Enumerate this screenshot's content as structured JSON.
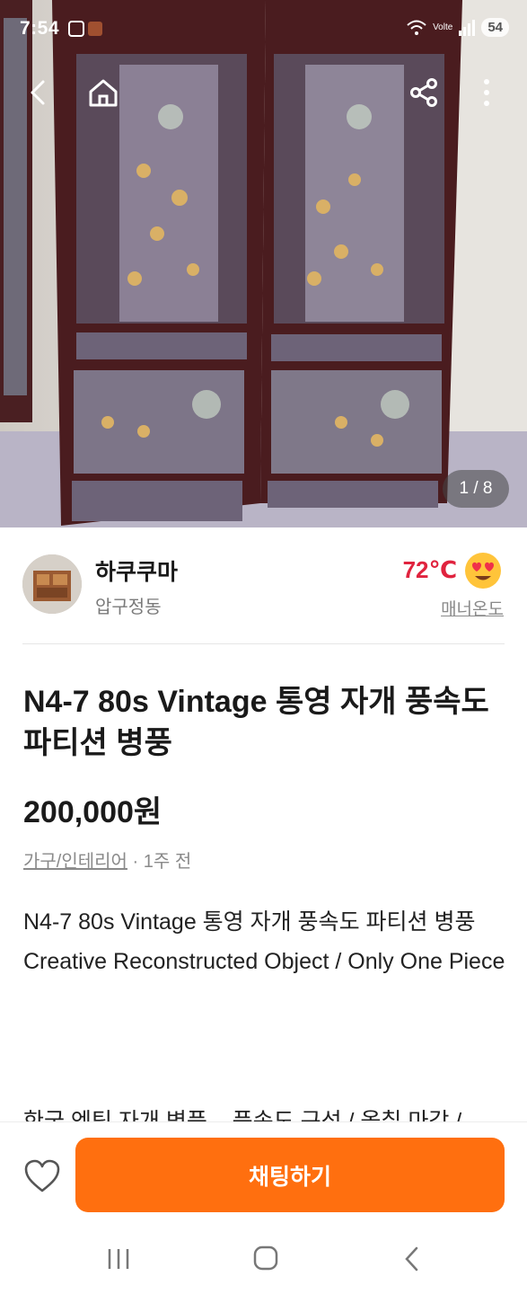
{
  "status_bar": {
    "time": "7:54",
    "network": "Volte",
    "battery": "54"
  },
  "gallery": {
    "counter": "1 / 8"
  },
  "seller": {
    "name": "하쿠쿠마",
    "location": "압구정동",
    "temperature": "72℃",
    "temperature_label": "매너온도",
    "temperature_color": "#e0233e"
  },
  "product": {
    "title": "N4-7 80s Vintage 통영 자개 풍속도 파티션 병풍",
    "price": "200,000원",
    "category": "가구/인테리어",
    "time_ago": "· 1주 전",
    "description_lines": [
      "N4-7 80s Vintage 통영 자개 풍속도 파티션 병풍",
      "Creative Reconstructed Object / Only One Piece"
    ],
    "description_cut": "한국 엔틱 자개 병풍 – 풍속도 구성 / 옻칠 마감 /"
  },
  "actions": {
    "chat_label": "채팅하기",
    "accent": "#ff6f0f"
  },
  "icons": [
    "back-icon",
    "home-icon",
    "share-icon",
    "more-icon",
    "heart-icon",
    "recents-icon",
    "home-nav-icon",
    "back-nav-icon"
  ]
}
